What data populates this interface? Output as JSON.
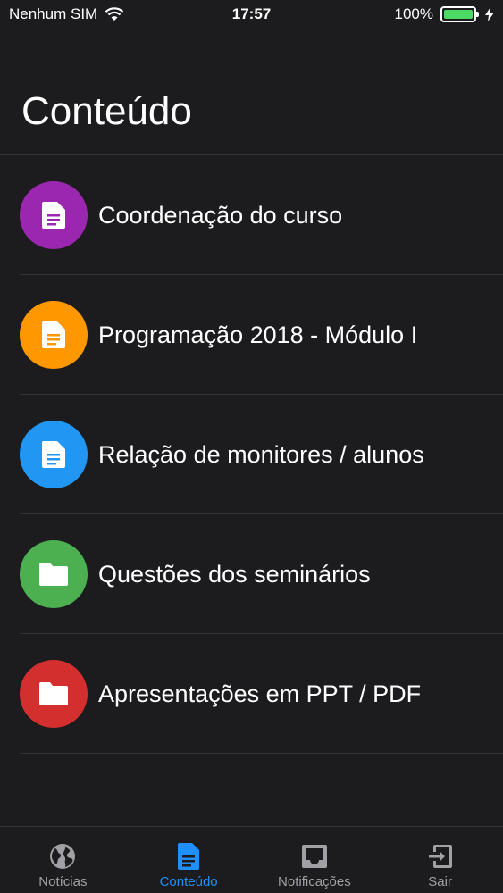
{
  "status_bar": {
    "carrier": "Nenhum SIM",
    "time": "17:57",
    "battery": "100%",
    "battery_level": 1.0
  },
  "header": {
    "title": "Conteúdo"
  },
  "items": [
    {
      "label": "Coordenação do curso",
      "color": "#9b27b0",
      "icon": "document-icon"
    },
    {
      "label": "Programação 2018 - Módulo I",
      "color": "#ff9800",
      "icon": "document-icon"
    },
    {
      "label": "Relação de monitores / alunos",
      "color": "#2196f3",
      "icon": "document-icon"
    },
    {
      "label": "Questões dos seminários",
      "color": "#4caf50",
      "icon": "folder-icon"
    },
    {
      "label": "Apresentações em PPT / PDF",
      "color": "#d32f2f",
      "icon": "folder-icon"
    }
  ],
  "tabs": [
    {
      "label": "Notícias",
      "icon": "globe-icon",
      "active": false
    },
    {
      "label": "Conteúdo",
      "icon": "document-icon",
      "active": true
    },
    {
      "label": "Notificações",
      "icon": "inbox-icon",
      "active": false
    },
    {
      "label": "Sair",
      "icon": "exit-icon",
      "active": false
    }
  ],
  "colors": {
    "accent": "#1e90ff",
    "background": "#1c1c1e",
    "battery": "#4cd964"
  }
}
